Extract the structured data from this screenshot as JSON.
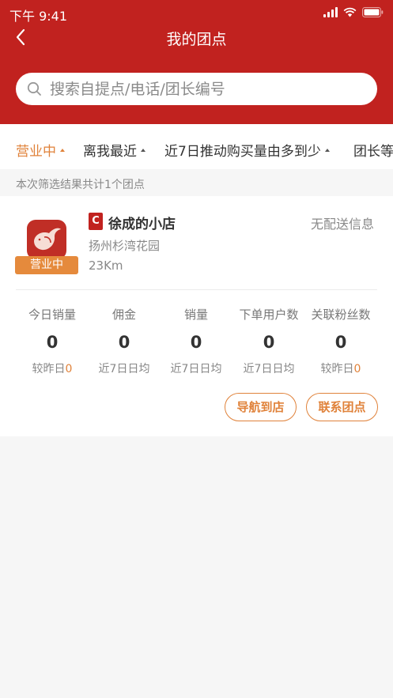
{
  "status_bar": {
    "time": "下午 9:41"
  },
  "nav": {
    "title": "我的团点"
  },
  "search": {
    "placeholder": "搜索自提点/电话/团长编号"
  },
  "filters": [
    {
      "label": "营业中",
      "active": true
    },
    {
      "label": "离我最近",
      "active": false
    },
    {
      "label": "近7日推动购买量由多到少",
      "active": false
    },
    {
      "label": "团长等",
      "active": false
    }
  ],
  "result_summary": "本次筛选结果共计1个团点",
  "shop": {
    "status_tag": "营业中",
    "badge": "C",
    "name": "徐成的小店",
    "delivery": "无配送信息",
    "address": "扬州杉湾花园",
    "distance": "23Km",
    "stats": [
      {
        "label": "今日销量",
        "value": "0",
        "sub_text": "较昨日",
        "sub_value": "0"
      },
      {
        "label": "佣金",
        "value": "0",
        "sub_text": "近7日日均",
        "sub_value": ""
      },
      {
        "label": "销量",
        "value": "0",
        "sub_text": "近7日日均",
        "sub_value": ""
      },
      {
        "label": "下单用户数",
        "value": "0",
        "sub_text": "近7日日均",
        "sub_value": ""
      },
      {
        "label": "关联粉丝数",
        "value": "0",
        "sub_text": "较昨日",
        "sub_value": "0"
      }
    ],
    "actions": {
      "navigate": "导航到店",
      "contact": "联系团点"
    }
  },
  "colors": {
    "brand_red": "#c1221f",
    "accent_orange": "#e0823a"
  }
}
